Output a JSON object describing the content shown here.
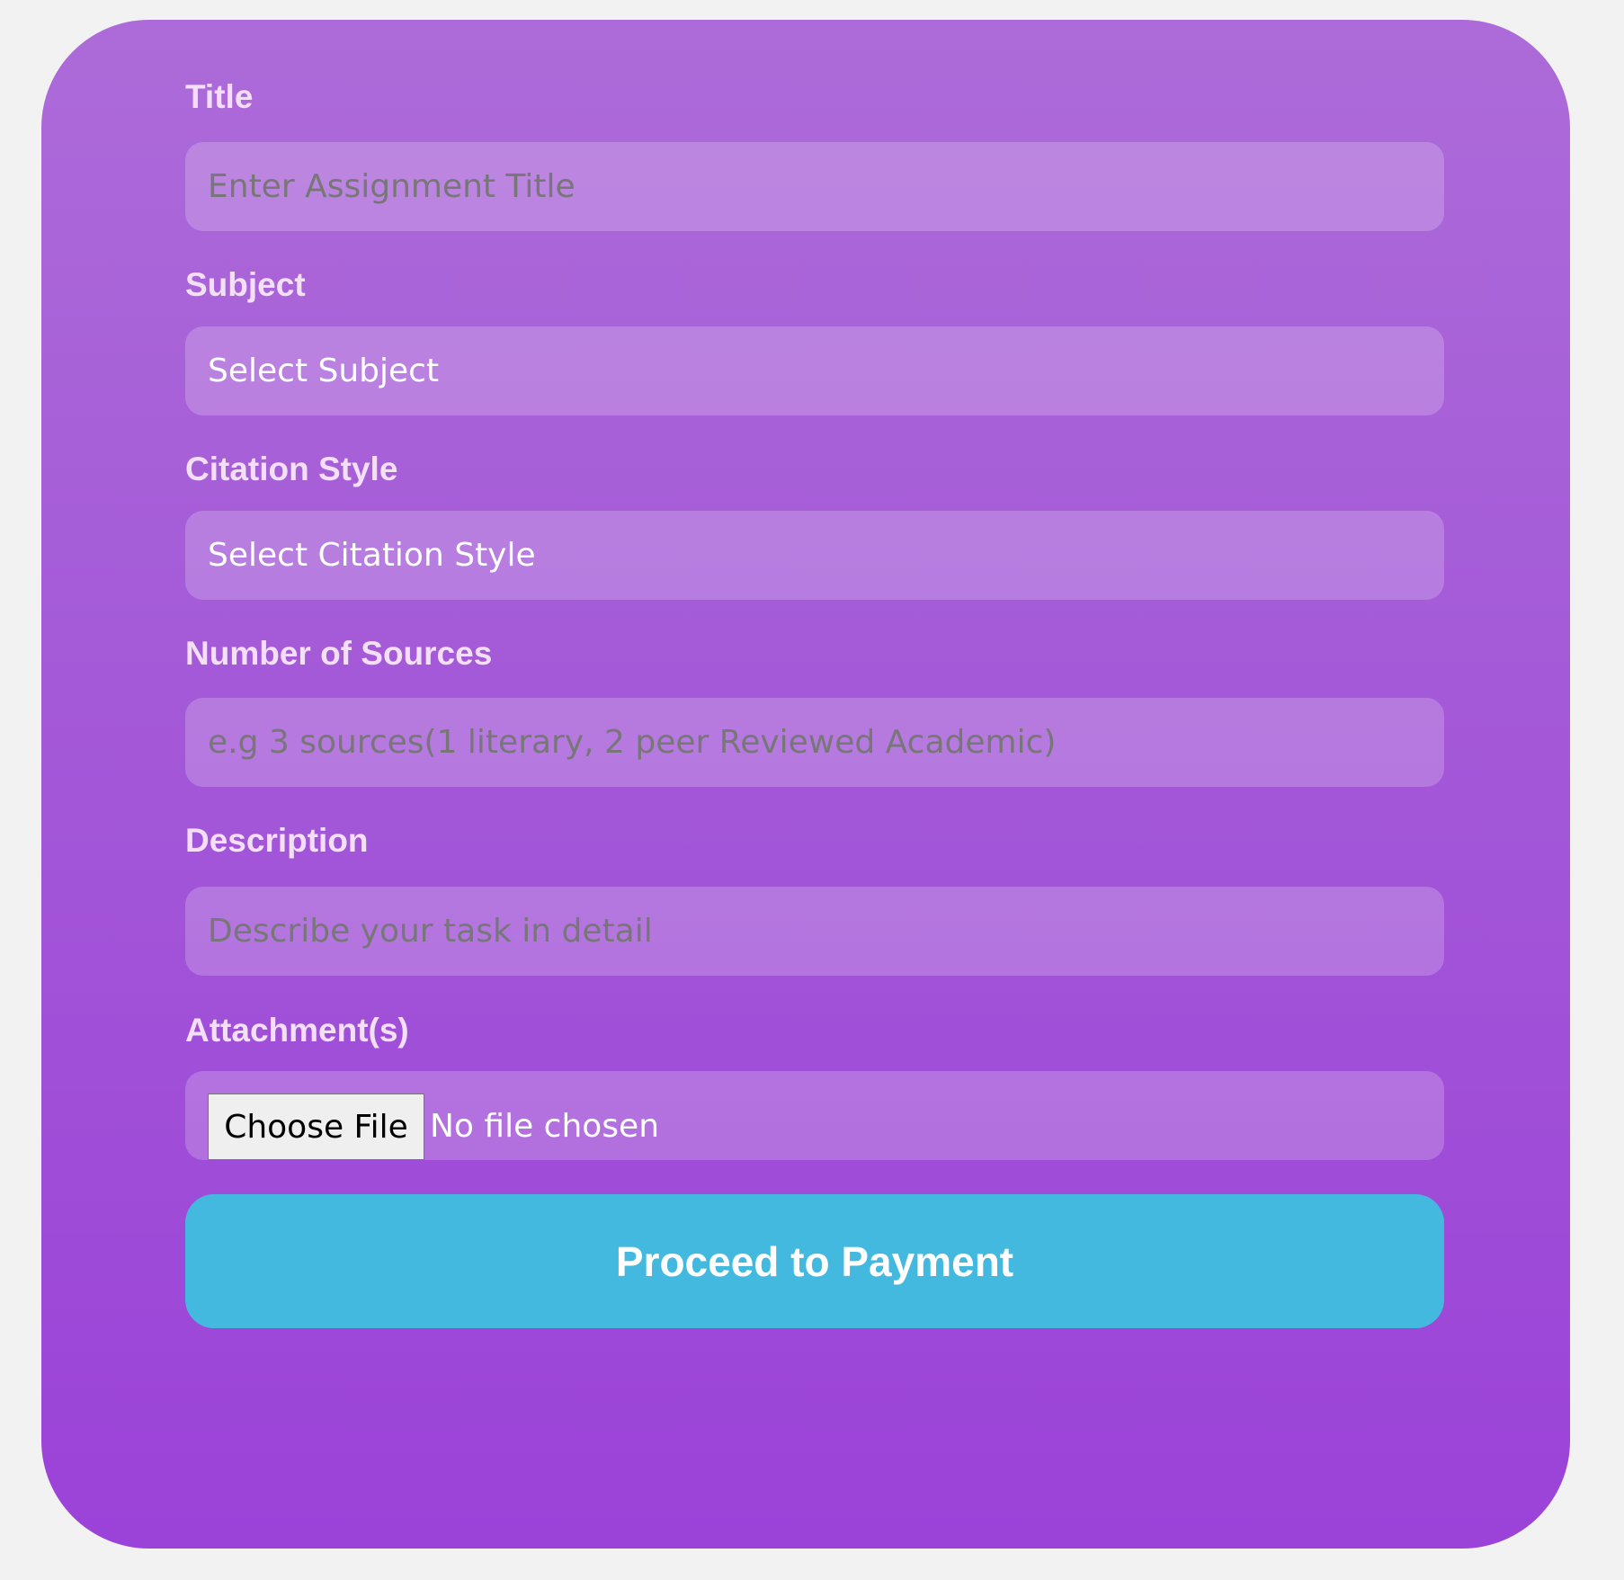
{
  "form": {
    "title": {
      "label": "Title",
      "placeholder": "Enter Assignment Title"
    },
    "subject": {
      "label": "Subject",
      "value": "Select Subject"
    },
    "citation": {
      "label": "Citation Style",
      "value": "Select Citation Style"
    },
    "sources": {
      "label": "Number of Sources",
      "placeholder": "e.g 3 sources(1 literary, 2 peer Reviewed Academic)"
    },
    "description": {
      "label": "Description",
      "placeholder": "Describe your task in detail"
    },
    "attachments": {
      "label": "Attachment(s)",
      "button": "Choose File",
      "status": "No file chosen"
    },
    "submit_label": "Proceed to Payment"
  },
  "colors": {
    "card_top": "#ad6bd9",
    "card_bottom": "#9b42d8",
    "submit": "#43b9e0"
  }
}
